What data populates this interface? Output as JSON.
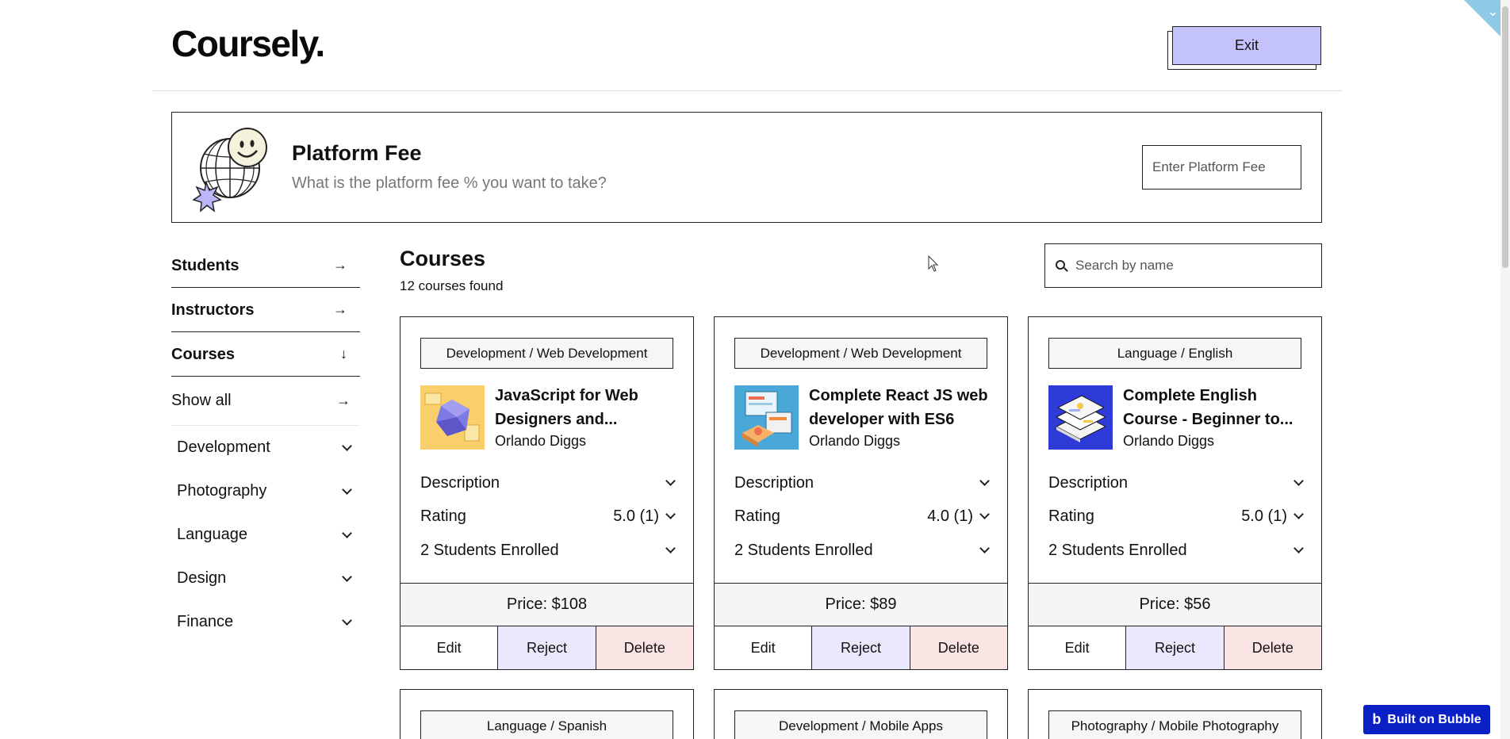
{
  "header": {
    "logo": "Coursely.",
    "exit_label": "Exit"
  },
  "platform_fee": {
    "title": "Platform Fee",
    "subtitle": "What is the platform fee % you want to take?",
    "input_placeholder": "Enter Platform Fee"
  },
  "sidebar": {
    "nav": [
      {
        "label": "Students",
        "icon": "arrow-right-icon"
      },
      {
        "label": "Instructors",
        "icon": "arrow-right-icon"
      },
      {
        "label": "Courses",
        "icon": "arrow-down-icon"
      }
    ],
    "show_all": "Show all",
    "categories": [
      "Development",
      "Photography",
      "Language",
      "Design",
      "Finance"
    ]
  },
  "courses": {
    "title": "Courses",
    "count": "12 courses found",
    "search_placeholder": "Search by name",
    "cards": [
      {
        "category": "Development / Web Development",
        "title": "JavaScript for Web Designers and...",
        "instructor": "Orlando Diggs",
        "description_label": "Description",
        "rating_label": "Rating",
        "rating_value": "5.0 (1)",
        "enrolled": "2 Students Enrolled",
        "price": "Price: $108",
        "edit": "Edit",
        "reject": "Reject",
        "delete": "Delete"
      },
      {
        "category": "Development / Web Development",
        "title": "Complete React JS web developer with ES6",
        "instructor": "Orlando Diggs",
        "description_label": "Description",
        "rating_label": "Rating",
        "rating_value": "4.0 (1)",
        "enrolled": "2 Students Enrolled",
        "price": "Price: $89",
        "edit": "Edit",
        "reject": "Reject",
        "delete": "Delete"
      },
      {
        "category": "Language / English",
        "title": "Complete English Course - Beginner to...",
        "instructor": "Orlando Diggs",
        "description_label": "Description",
        "rating_label": "Rating",
        "rating_value": "5.0 (1)",
        "enrolled": "2 Students Enrolled",
        "price": "Price: $56",
        "edit": "Edit",
        "reject": "Reject",
        "delete": "Delete"
      },
      {
        "category": "Language / Spanish"
      },
      {
        "category": "Development / Mobile Apps"
      },
      {
        "category": "Photography / Mobile Photography"
      }
    ]
  },
  "badge": {
    "label": "Built on Bubble",
    "logo": "b"
  },
  "colors": {
    "exit_bg": "#c5c3fb",
    "reject_bg": "#e9e8fc",
    "delete_bg": "#fbe4e4",
    "bubble_bg": "#0b20c4"
  }
}
